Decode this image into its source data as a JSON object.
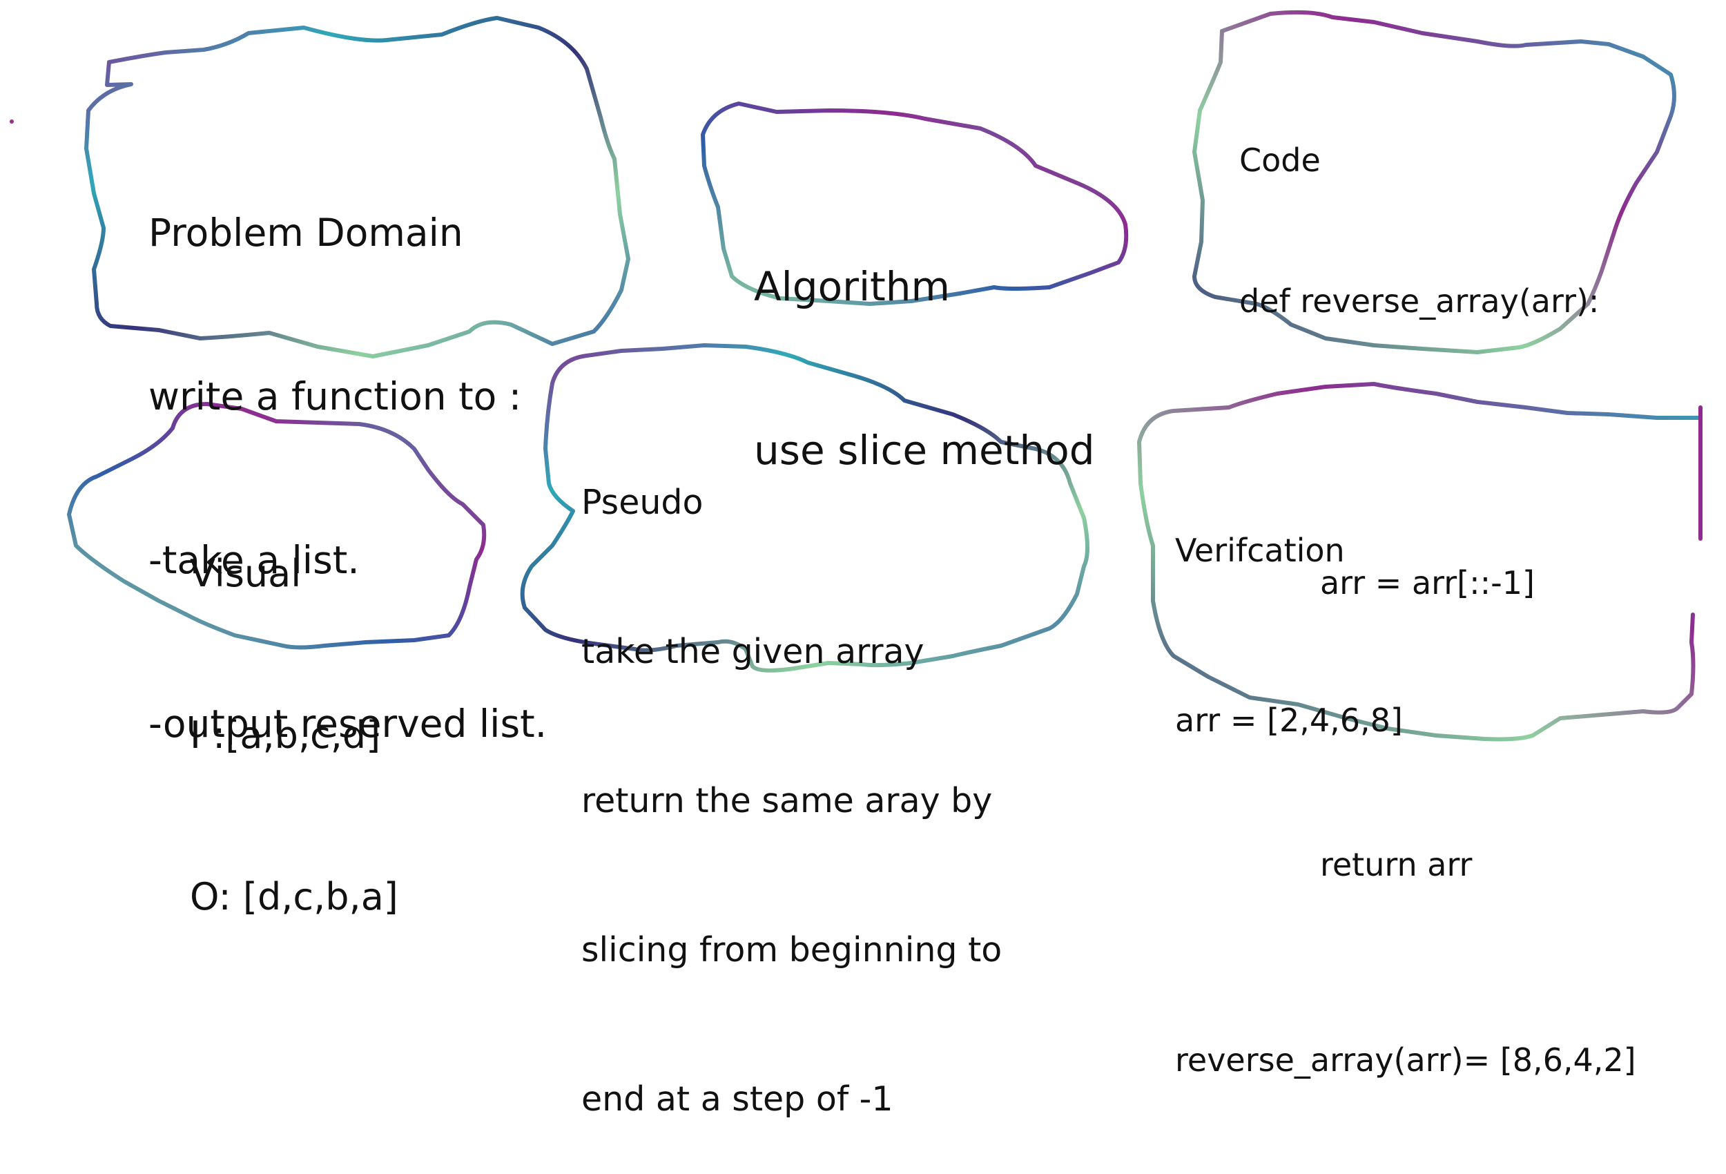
{
  "colors": {
    "outline_purple": "#8e2b8f",
    "outline_blue": "#2f5ea8",
    "outline_teal": "#2fa9b8",
    "outline_green": "#8ed1a0",
    "outline_navy": "#35327a",
    "text": "#111111"
  },
  "notes": {
    "problem_domain": {
      "lines": [
        "Problem Domain",
        "write a function to :",
        "-take a list.",
        "-output reserved list."
      ]
    },
    "algorithm": {
      "lines": [
        "Algorithm",
        "use slice method"
      ]
    },
    "code": {
      "lines": [
        "Code",
        "def reverse_array(arr):",
        "",
        "        arr = arr[::-1]",
        "",
        "        return arr"
      ]
    },
    "visual": {
      "lines": [
        "Visual",
        "I :[a,b,c,d]",
        "O: [d,c,b,a]"
      ]
    },
    "pseudo": {
      "lines": [
        "Pseudo",
        "take the given array",
        "return the same aray by",
        "slicing from beginning to",
        "end at a step of -1"
      ]
    },
    "verification": {
      "lines": [
        "Verifcation",
        "arr = [2,4,6,8]",
        "",
        "reverse_array(arr)= [8,6,4,2]"
      ]
    }
  }
}
